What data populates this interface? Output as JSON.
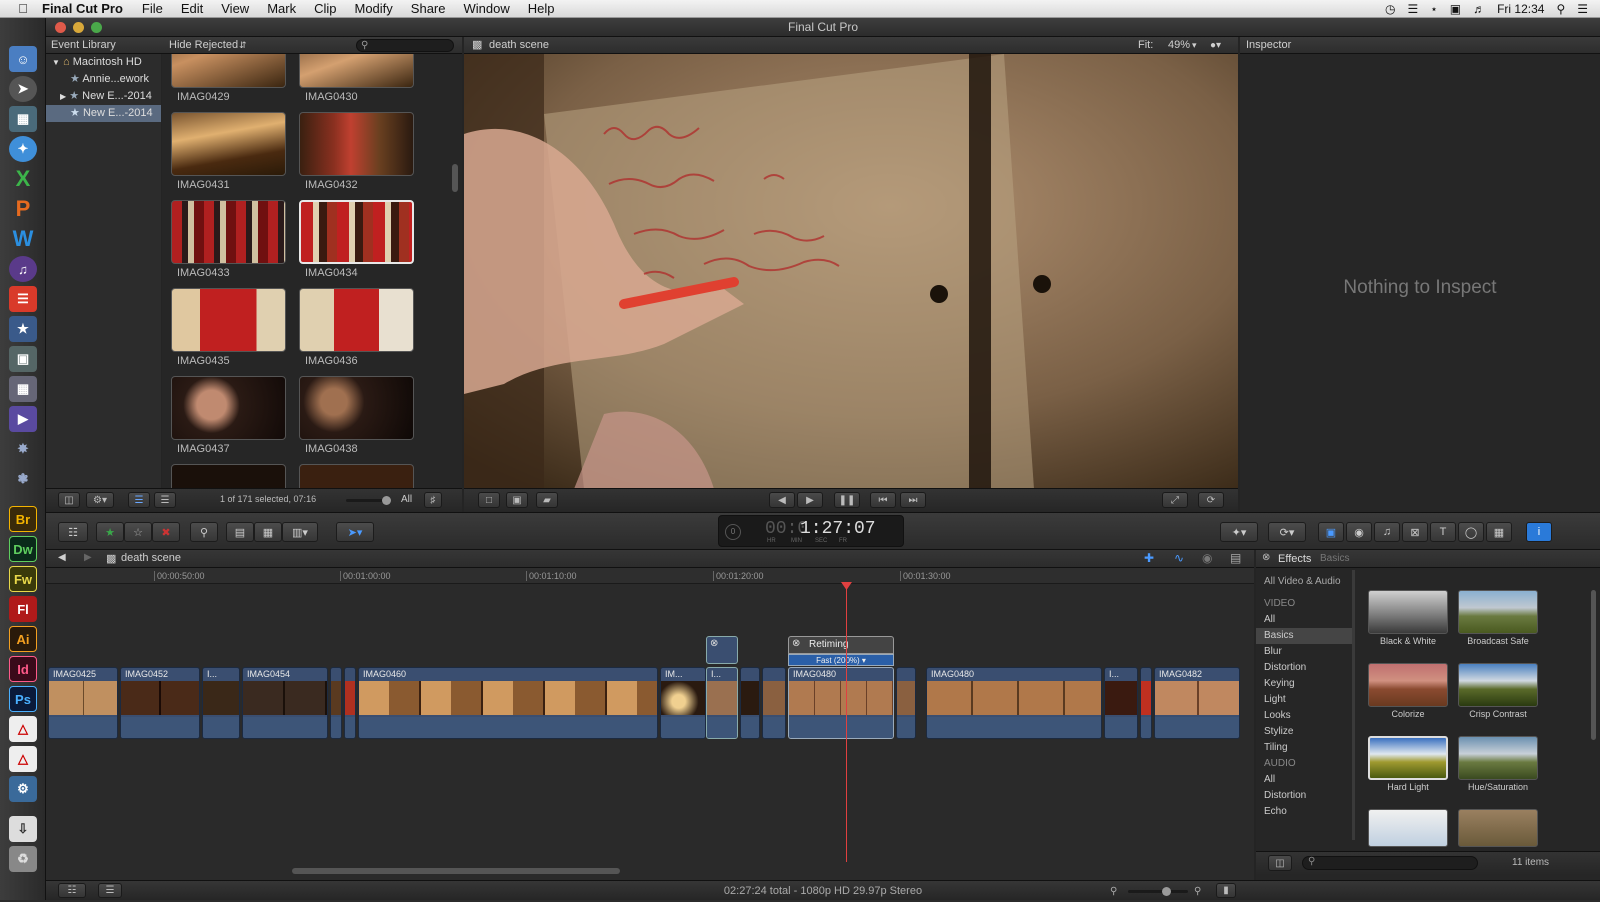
{
  "menubar": {
    "app_name": "Final Cut Pro",
    "items": [
      "File",
      "Edit",
      "View",
      "Mark",
      "Clip",
      "Modify",
      "Share",
      "Window",
      "Help"
    ],
    "clock": "Fri 12:34"
  },
  "window": {
    "title": "Final Cut Pro"
  },
  "event_library": {
    "title": "Event Library",
    "filter": "Hide Rejected",
    "items": [
      {
        "label": "Macintosh HD"
      },
      {
        "label": "Annie...ework"
      },
      {
        "label": "New E...-2014"
      },
      {
        "label": "New E...-2014"
      }
    ],
    "selection_status": "1 of 171 selected, 07:16",
    "all_label": "All"
  },
  "browser": {
    "clips": [
      "IMAG0429",
      "IMAG0430",
      "IMAG0431",
      "IMAG0432",
      "IMAG0433",
      "IMAG0434",
      "IMAG0435",
      "IMAG0436",
      "IMAG0437",
      "IMAG0438"
    ]
  },
  "viewer": {
    "title": "death scene",
    "fit_label": "Fit:",
    "zoom": "49%"
  },
  "inspector": {
    "title": "Inspector",
    "empty_message": "Nothing to Inspect"
  },
  "timecode": {
    "display": "1:27:07",
    "faded": "00:0",
    "units": [
      "HR",
      "MIN",
      "SEC",
      "FR"
    ]
  },
  "timeline": {
    "project": "death scene",
    "ruler": [
      "00:00:50:00",
      "00:01:00:00",
      "00:01:10:00",
      "00:01:20:00",
      "00:01:30:00"
    ],
    "clips": [
      "IMAG0425",
      "IMAG0452",
      "I...",
      "IMAG0454",
      "IMAG0460",
      "IM...",
      "I...",
      "IMAG0480",
      "IMAG0480",
      "I...",
      "IMAG0482"
    ],
    "retiming_label": "Retiming",
    "retiming_speed": "Fast (200%) ▾"
  },
  "effects": {
    "title": "Effects",
    "subtitle": "Basics",
    "all_label": "All Video & Audio",
    "video_heading": "VIDEO",
    "video_categories": [
      "All",
      "Basics",
      "Blur",
      "Distortion",
      "Keying",
      "Light",
      "Looks",
      "Stylize",
      "Tiling"
    ],
    "audio_heading": "AUDIO",
    "audio_categories": [
      "All",
      "Distortion",
      "Echo"
    ],
    "items": [
      "Black & White",
      "Broadcast Safe",
      "Colorize",
      "Crisp Contrast",
      "Hard Light",
      "Hue/Saturation"
    ],
    "count": "11 items"
  },
  "status": {
    "text": "02:27:24 total - 1080p HD 29.97p Stereo"
  }
}
